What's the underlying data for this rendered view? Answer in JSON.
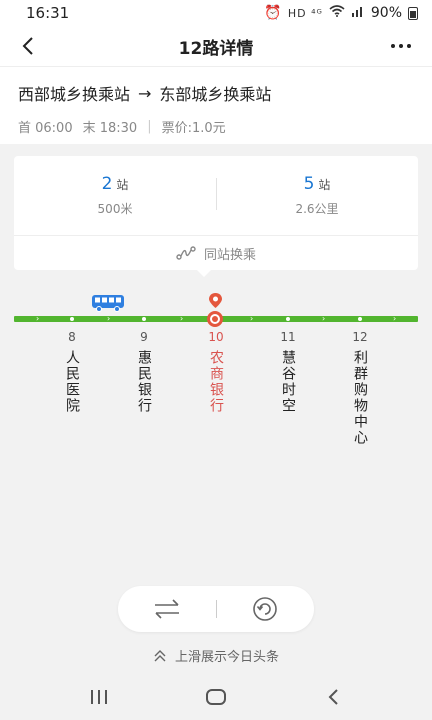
{
  "status": {
    "time": "16:31",
    "indicators": "HD ⁴ᴳ",
    "battery": "90%"
  },
  "header": {
    "title": "12路详情",
    "back_icon": "chevron-left-icon",
    "more_icon": "more-horizontal-icon"
  },
  "route": {
    "from": "西部城乡换乘站",
    "arrow": "→",
    "to": "东部城乡换乘站",
    "first_bus": "首 06:00",
    "last_bus": "末 18:30",
    "separator": "|",
    "fare": "票价:1.0元"
  },
  "summary": {
    "left": {
      "count": "2",
      "unit": "站",
      "distance": "500米"
    },
    "right": {
      "count": "5",
      "unit": "站",
      "distance": "2.6公里"
    },
    "transfer_label": "同站换乘",
    "transfer_icon": "route-icon"
  },
  "stops": [
    {
      "number": "8",
      "name": "人民医院",
      "current": false
    },
    {
      "number": "9",
      "name": "惠民银行",
      "current": false
    },
    {
      "number": "10",
      "name": "农商银行",
      "current": true
    },
    {
      "number": "11",
      "name": "慧谷时空",
      "current": false
    },
    {
      "number": "12",
      "name": "利群购物中心",
      "current": false
    }
  ],
  "actions": {
    "swap_icon": "swap-direction-icon",
    "refresh_icon": "refresh-icon",
    "swipe_hint": "上滑展示今日头条",
    "swipe_icon": "double-chevron-up-icon"
  },
  "colors": {
    "line_green": "#52b52f",
    "accent_blue": "#1976d2",
    "current_red": "#e4573d"
  }
}
